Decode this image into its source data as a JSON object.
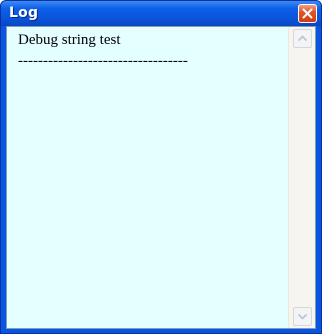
{
  "window": {
    "title": "Log"
  },
  "log": {
    "lines": [
      "Debug string test",
      "----------------------------------"
    ]
  },
  "icons": {
    "close": "close-icon",
    "scroll_up": "chevron-up-icon",
    "scroll_down": "chevron-down-icon"
  },
  "colors": {
    "titlebar": "#0a55e0",
    "log_background": "#e3ffff",
    "close_button": "#e2562c"
  }
}
